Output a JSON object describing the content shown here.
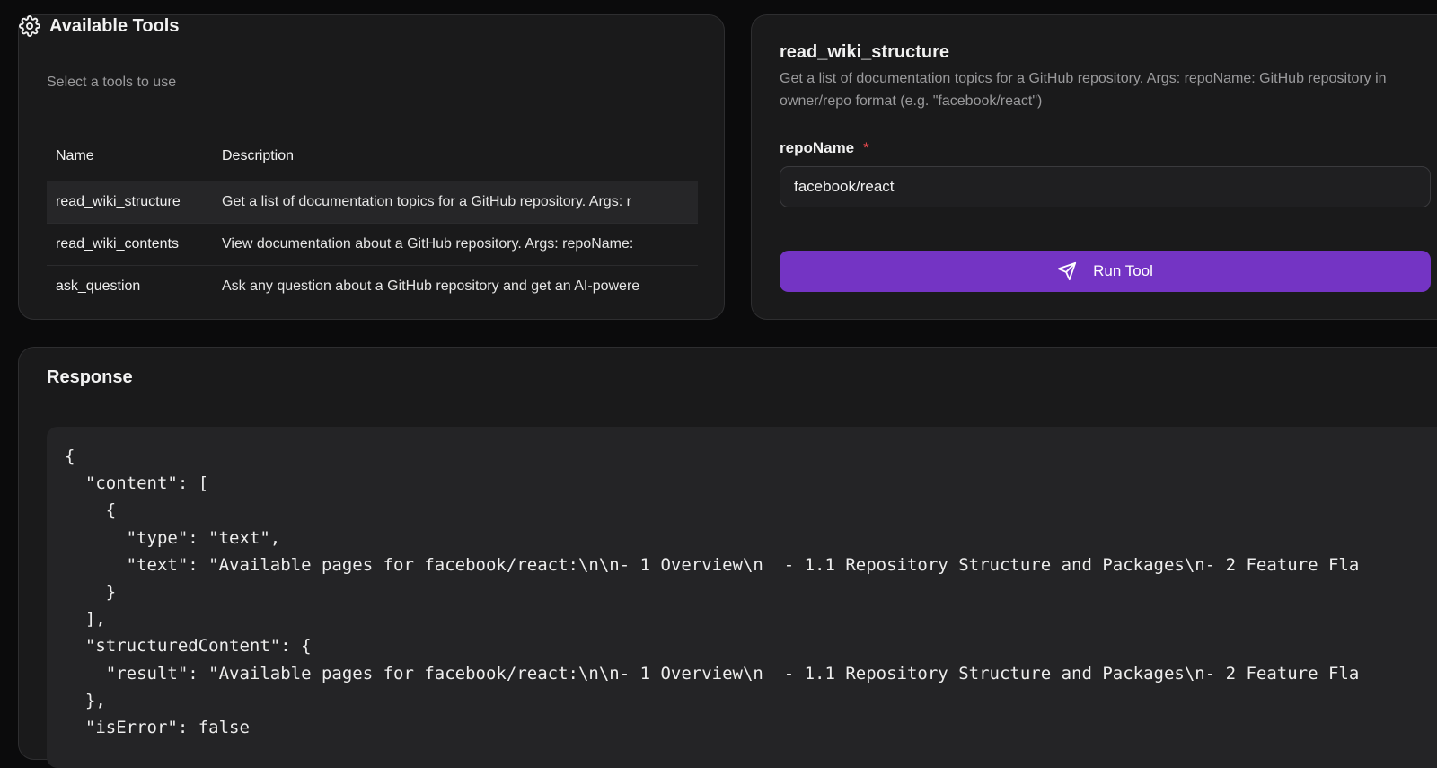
{
  "tools_panel": {
    "title": "Available Tools",
    "subtitle": "Select a tools to use",
    "columns": {
      "name": "Name",
      "description": "Description"
    },
    "rows": [
      {
        "name": "read_wiki_structure",
        "description": "Get a list of documentation topics for a GitHub repository. Args: r"
      },
      {
        "name": "read_wiki_contents",
        "description": "View documentation about a GitHub repository. Args: repoName:"
      },
      {
        "name": "ask_question",
        "description": "Ask any question about a GitHub repository and get an AI-powere"
      }
    ]
  },
  "tool_detail": {
    "title": "read_wiki_structure",
    "description": "Get a list of documentation topics for a GitHub repository. Args: repoName: GitHub repository in owner/repo format (e.g. \"facebook/react\")",
    "param_label": "repoName",
    "required_mark": "*",
    "param_value": "facebook/react",
    "run_label": "Run Tool"
  },
  "response": {
    "title": "Response",
    "code": "{\n  \"content\": [\n    {\n      \"type\": \"text\",\n      \"text\": \"Available pages for facebook/react:\\n\\n- 1 Overview\\n  - 1.1 Repository Structure and Packages\\n- 2 Feature Fla\n    }\n  ],\n  \"structuredContent\": {\n    \"result\": \"Available pages for facebook/react:\\n\\n- 1 Overview\\n  - 1.1 Repository Structure and Packages\\n- 2 Feature Fla\n  },\n  \"isError\": false"
  },
  "icons": {
    "tools": "gear-icon",
    "run": "send-icon"
  },
  "colors": {
    "accent": "#7434c4",
    "required": "#e5484d",
    "background": "#0b0b0c",
    "card": "#1a1a1b"
  }
}
